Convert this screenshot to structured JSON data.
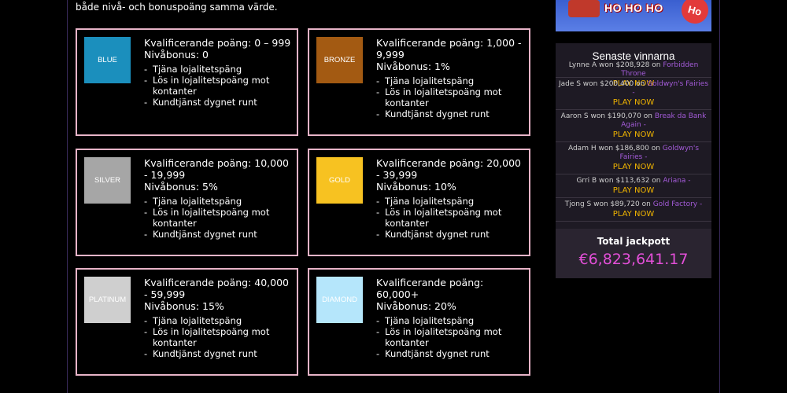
{
  "intro": "både nivå- och bonuspoäng samma värde.",
  "perks": [
    "Tjäna lojalitetspäng",
    "Lös in lojalitetspoäng mot kontanter",
    "Kundtjänst dygnet runt"
  ],
  "tiers": [
    {
      "badge": "BLUE",
      "color": "#1b8fbd",
      "qual": "Kvalificerande poäng: 0 – 999",
      "bonus": "Nivåbonus: 0"
    },
    {
      "badge": "BRONZE",
      "color": "#a35a12",
      "qual": "Kvalificerande poäng: 1,000 - 9,999",
      "bonus": "Nivåbonus: 1%"
    },
    {
      "badge": "SILVER",
      "color": "#a6a6a6",
      "qual": "Kvalificerande poäng: 10,000 - 19,999",
      "bonus": "Nivåbonus: 5%"
    },
    {
      "badge": "GOLD",
      "color": "#f7c221",
      "qual": "Kvalificerande poäng: 20,000 - 39,999",
      "bonus": "Nivåbonus: 10%"
    },
    {
      "badge": "PLATINUM",
      "color": "#cfcfcf",
      "qual": "Kvalificerande poäng: 40,000 - 59,999",
      "bonus": "Nivåbonus: 15%"
    },
    {
      "badge": "DIAMOND",
      "color": "#b5e6fb",
      "qual": "Kvalificerande poäng: 60,000+",
      "bonus": "Nivåbonus: 20%"
    }
  ],
  "promo": {
    "text": "HO HO HO",
    "badge": "Ho"
  },
  "winners": {
    "title": "Senaste vinnarna",
    "items": [
      {
        "text": "Lynne A won $208,928 on ",
        "game": "Forbidden Throne",
        "play": "PLAY NOW"
      },
      {
        "text": "Jade S won $200,400 on ",
        "game": "Goldwyn's Fairies -",
        "play": "PLAY NOW"
      },
      {
        "text": "Aaron S won $190,070 on ",
        "game": "Break da Bank Again -",
        "play": "PLAY NOW"
      },
      {
        "text": "Adam H won $186,800 on ",
        "game": "Goldwyn's Fairies -",
        "play": "PLAY NOW"
      },
      {
        "text": "Grri B won $113,632 on ",
        "game": "Ariana -",
        "play": "PLAY NOW"
      },
      {
        "text": "Tjong S won $89,720 on ",
        "game": "Gold Factory -",
        "play": "PLAY NOW"
      }
    ]
  },
  "jackpot": {
    "label": "Total jackpott",
    "value": "€6,823,641.17"
  }
}
